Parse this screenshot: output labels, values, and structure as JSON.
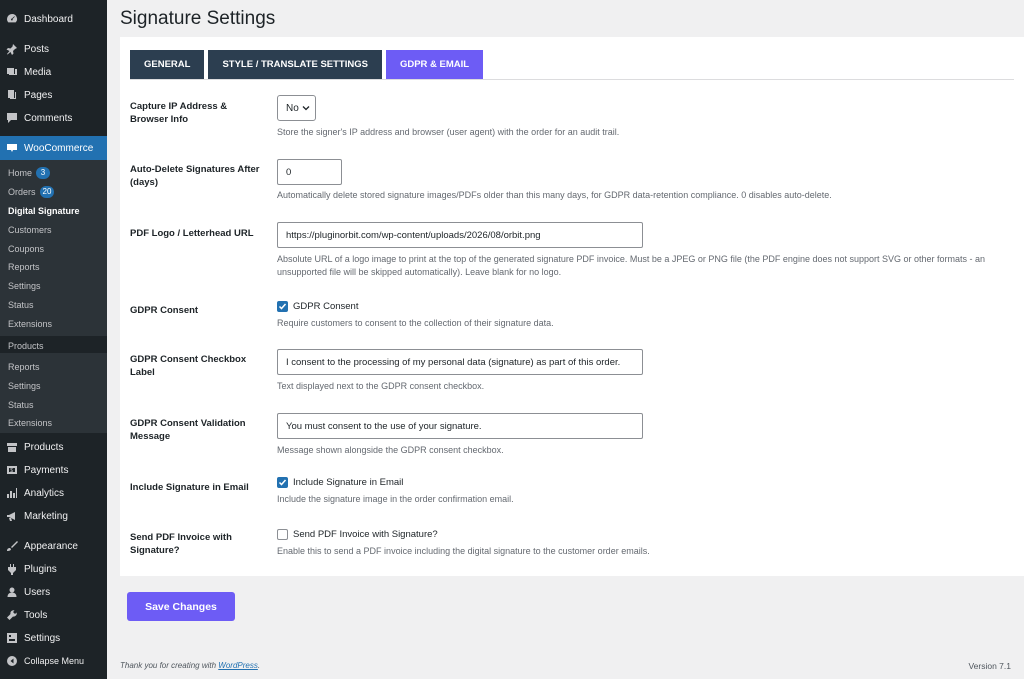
{
  "sidebar": {
    "dashboard": "Dashboard",
    "posts": "Posts",
    "media": "Media",
    "pages": "Pages",
    "comments": "Comments",
    "woocommerce": "WooCommerce",
    "woo_sub": [
      {
        "label": "Home",
        "badge": "3"
      },
      {
        "label": "Orders",
        "badge": "20"
      },
      {
        "label": "Digital Signature"
      },
      {
        "label": "Customers"
      },
      {
        "label": "Coupons"
      },
      {
        "label": "Reports"
      },
      {
        "label": "Settings"
      },
      {
        "label": "Status"
      },
      {
        "label": "Extensions"
      }
    ],
    "ghost_sub": "Products",
    "dup_sub": [
      "Reports",
      "Settings",
      "Status",
      "Extensions"
    ],
    "products": "Products",
    "payments": "Payments",
    "analytics": "Analytics",
    "marketing": "Marketing",
    "appearance": "Appearance",
    "plugins": "Plugins",
    "users": "Users",
    "tools": "Tools",
    "settings": "Settings",
    "collapse": "Collapse Menu"
  },
  "page_title": "Signature Settings",
  "tabs": [
    "GENERAL",
    "STYLE / TRANSLATE SETTINGS",
    "GDPR & EMAIL"
  ],
  "active_tab": "GDPR & EMAIL",
  "fields": {
    "capture_ip": {
      "label": "Capture IP Address & Browser Info",
      "value": "No",
      "desc": "Store the signer's IP address and browser (user agent) with the order for an audit trail."
    },
    "auto_delete": {
      "label": "Auto-Delete Signatures After (days)",
      "value": "0",
      "desc": "Automatically delete stored signature images/PDFs older than this many days, for GDPR data-retention compliance. 0 disables auto-delete."
    },
    "pdf_logo": {
      "label": "PDF Logo / Letterhead URL",
      "value": "https://pluginorbit.com/wp-content/uploads/2026/08/orbit.png",
      "desc": "Absolute URL of a logo image to print at the top of the generated signature PDF invoice. Must be a JPEG or PNG file (the PDF engine does not support SVG or other formats - an unsupported file will be skipped automatically). Leave blank for no logo."
    },
    "gdpr_consent": {
      "label": "GDPR Consent",
      "checkbox_label": "GDPR Consent",
      "checked": true,
      "desc": "Require customers to consent to the collection of their signature data."
    },
    "gdpr_checkbox_label": {
      "label": "GDPR Consent Checkbox Label",
      "value": "I consent to the processing of my personal data (signature) as part of this order.",
      "desc": "Text displayed next to the GDPR consent checkbox."
    },
    "gdpr_validation": {
      "label": "GDPR Consent Validation Message",
      "value": "You must consent to the use of your signature.",
      "desc": "Message shown alongside the GDPR consent checkbox."
    },
    "include_in_email": {
      "label": "Include Signature in Email",
      "checkbox_label": "Include Signature in Email",
      "checked": true,
      "desc": "Include the signature image in the order confirmation email."
    },
    "send_pdf": {
      "label": "Send PDF Invoice with Signature?",
      "checkbox_label": "Send PDF Invoice with Signature?",
      "checked": false,
      "desc": "Enable this to send a PDF invoice including the digital signature to the customer order emails."
    }
  },
  "save_button": "Save Changes",
  "footer": {
    "thanks_prefix": "Thank you for creating with ",
    "thanks_link": "WordPress",
    "thanks_suffix": ".",
    "version": "Version 7.1"
  },
  "colors": {
    "sidebar_bg": "#1d2327",
    "woo_active": "#2271b1",
    "tab_dark": "#2c3e50",
    "tab_active": "#6d5cf5",
    "save_button": "#6d5cf5"
  }
}
